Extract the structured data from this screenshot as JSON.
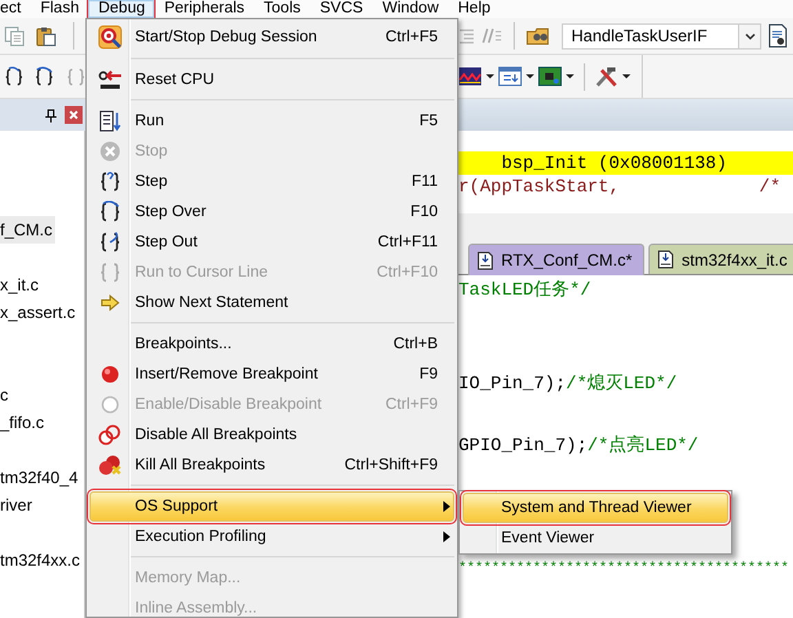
{
  "menubar": [
    {
      "label": "ect",
      "selected": false,
      "annotated": false
    },
    {
      "label": "Flash",
      "selected": false,
      "annotated": false
    },
    {
      "label": "Debug",
      "selected": true,
      "annotated": true
    },
    {
      "label": "Peripherals",
      "selected": false,
      "annotated": false
    },
    {
      "label": "Tools",
      "selected": false,
      "annotated": false
    },
    {
      "label": "SVCS",
      "selected": false,
      "annotated": false
    },
    {
      "label": "Window",
      "selected": false,
      "annotated": false
    },
    {
      "label": "Help",
      "selected": false,
      "annotated": false
    }
  ],
  "toolbar": {
    "function_combo": {
      "value": "HandleTaskUserIF"
    }
  },
  "project_panel": {
    "files": [
      {
        "kind": "file",
        "label": "f_CM.c",
        "selected": true
      },
      {
        "kind": "blank"
      },
      {
        "kind": "file",
        "label": "x_it.c",
        "selected": false
      },
      {
        "kind": "file",
        "label": "x_assert.c",
        "selected": false
      },
      {
        "kind": "blank"
      },
      {
        "kind": "blank"
      },
      {
        "kind": "file",
        "label": "c",
        "selected": false
      },
      {
        "kind": "file",
        "label": "_fifo.c",
        "selected": false
      },
      {
        "kind": "blank"
      },
      {
        "kind": "file",
        "label": "tm32f40_4",
        "selected": false
      },
      {
        "kind": "file",
        "label": "river",
        "selected": false
      },
      {
        "kind": "blank"
      },
      {
        "kind": "file",
        "label": "tm32f4xx.c",
        "selected": false
      }
    ]
  },
  "editor": {
    "upper_lines": [
      {
        "kind": "line",
        "highlighted": true,
        "segments": [
          {
            "kind": "code",
            "text": "    bsp_Init (0x08001138)"
          }
        ]
      },
      {
        "kind": "line",
        "highlighted": false,
        "segments": [
          {
            "kind": "call",
            "text": "r(AppTaskStart,             /*"
          }
        ]
      }
    ],
    "tabs": [
      {
        "label": "RTX_Conf_CM.c*",
        "selected": true,
        "color": "#b9acdc"
      },
      {
        "label": "stm32f4xx_it.c",
        "selected": false,
        "color": "#c9d4ab"
      }
    ],
    "lower_lines": [
      {
        "kind": "line",
        "highlighted": false,
        "segments": [
          {
            "kind": "comment",
            "text": "TaskLED任务*/"
          }
        ]
      },
      {
        "kind": "blank"
      },
      {
        "kind": "blank"
      },
      {
        "kind": "line",
        "highlighted": false,
        "segments": [
          {
            "kind": "code",
            "text": "IO_Pin_7);"
          },
          {
            "kind": "comment",
            "text": "/*熄灭LED*/"
          }
        ]
      },
      {
        "kind": "blank"
      },
      {
        "kind": "line",
        "highlighted": false,
        "segments": [
          {
            "kind": "code",
            "text": "GPIO_Pin_7);"
          },
          {
            "kind": "comment",
            "text": "/*点亮LED*/"
          }
        ]
      },
      {
        "kind": "blank"
      },
      {
        "kind": "blank"
      },
      {
        "kind": "blank"
      },
      {
        "kind": "banner",
        "highlighted": false,
        "segments": [
          {
            "kind": "comment",
            "text": "****************************************"
          }
        ]
      }
    ]
  },
  "debug_menu": {
    "items": [
      {
        "kind": "item",
        "label": "Start/Stop Debug Session",
        "shortcut": "Ctrl+F5",
        "disabled": false,
        "selected": false,
        "annotated": false,
        "has_submenu": false
      },
      {
        "kind": "separator"
      },
      {
        "kind": "item",
        "label": "Reset CPU",
        "disabled": false,
        "selected": false,
        "annotated": false,
        "has_submenu": false
      },
      {
        "kind": "separator"
      },
      {
        "kind": "item",
        "label": "Run",
        "shortcut": "F5",
        "disabled": false,
        "selected": false,
        "annotated": false,
        "has_submenu": false
      },
      {
        "kind": "item",
        "label": "Stop",
        "disabled": true,
        "selected": false,
        "annotated": false,
        "has_submenu": false
      },
      {
        "kind": "item",
        "label": "Step",
        "shortcut": "F11",
        "disabled": false,
        "selected": false,
        "annotated": false,
        "has_submenu": false
      },
      {
        "kind": "item",
        "label": "Step Over",
        "shortcut": "F10",
        "disabled": false,
        "selected": false,
        "annotated": false,
        "has_submenu": false
      },
      {
        "kind": "item",
        "label": "Step Out",
        "shortcut": "Ctrl+F11",
        "disabled": false,
        "selected": false,
        "annotated": false,
        "has_submenu": false
      },
      {
        "kind": "item",
        "label": "Run to Cursor Line",
        "shortcut": "Ctrl+F10",
        "disabled": true,
        "selected": false,
        "annotated": false,
        "has_submenu": false
      },
      {
        "kind": "item",
        "label": "Show Next Statement",
        "disabled": false,
        "selected": false,
        "annotated": false,
        "has_submenu": false
      },
      {
        "kind": "separator"
      },
      {
        "kind": "item",
        "label": "Breakpoints...",
        "shortcut": "Ctrl+B",
        "disabled": false,
        "selected": false,
        "annotated": false,
        "has_submenu": false
      },
      {
        "kind": "item",
        "label": "Insert/Remove Breakpoint",
        "shortcut": "F9",
        "disabled": false,
        "selected": false,
        "annotated": false,
        "has_submenu": false
      },
      {
        "kind": "item",
        "label": "Enable/Disable Breakpoint",
        "shortcut": "Ctrl+F9",
        "disabled": true,
        "selected": false,
        "annotated": false,
        "has_submenu": false
      },
      {
        "kind": "item",
        "label": "Disable All Breakpoints",
        "disabled": false,
        "selected": false,
        "annotated": false,
        "has_submenu": false
      },
      {
        "kind": "item",
        "label": "Kill All Breakpoints",
        "shortcut": "Ctrl+Shift+F9",
        "disabled": false,
        "selected": false,
        "annotated": false,
        "has_submenu": false
      },
      {
        "kind": "separator"
      },
      {
        "kind": "item",
        "label": "OS Support",
        "disabled": false,
        "selected": true,
        "annotated": true,
        "has_submenu": true
      },
      {
        "kind": "item",
        "label": "Execution Profiling",
        "disabled": false,
        "selected": false,
        "annotated": false,
        "has_submenu": true
      },
      {
        "kind": "separator"
      },
      {
        "kind": "item",
        "label": "Memory Map...",
        "disabled": true,
        "selected": false,
        "annotated": false,
        "has_submenu": false
      },
      {
        "kind": "item",
        "label": "Inline Assembly...",
        "disabled": true,
        "selected": false,
        "annotated": false,
        "has_submenu": false
      }
    ]
  },
  "os_support_submenu": {
    "items": [
      {
        "label": "System and Thread Viewer",
        "selected": true,
        "annotated": true
      },
      {
        "label": "Event Viewer",
        "selected": false,
        "annotated": false
      }
    ]
  }
}
